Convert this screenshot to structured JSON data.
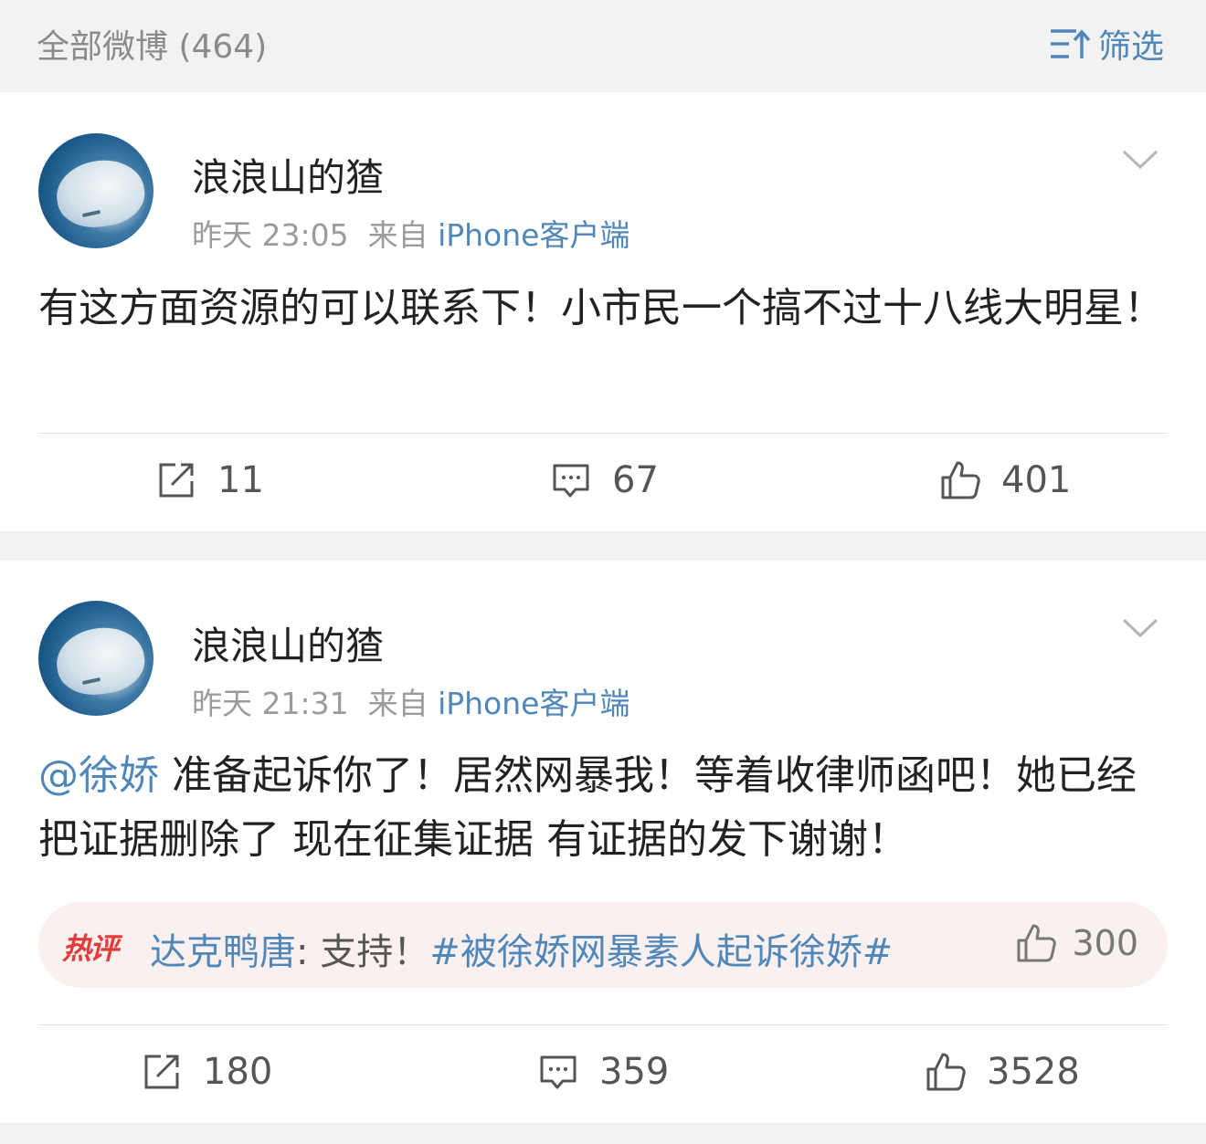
{
  "header": {
    "count_label": "全部微博 (464)",
    "filter_label": "筛选"
  },
  "posts": [
    {
      "username": "浪浪山的猹",
      "time": "昨天 23:05",
      "source_prefix": "来自",
      "source": "iPhone客户端",
      "text": "有这方面资源的可以联系下！小市民一个搞不过十八线大明星！",
      "reposts": "11",
      "comments": "67",
      "likes": "401"
    },
    {
      "username": "浪浪山的猹",
      "time": "昨天 21:31",
      "source_prefix": "来自",
      "source": "iPhone客户端",
      "mention": "@徐娇",
      "text": " 准备起诉你了！居然网暴我！等着收律师函吧！她已经把证据删除了 现在征集证据 有证据的发下谢谢！",
      "hot_comment": {
        "badge": "热评",
        "author": "达克鸭唐",
        "text": ": 支持！",
        "hashtag": "#被徐娇网暴素人起诉徐娇#",
        "likes": "300"
      },
      "reposts": "180",
      "comments": "359",
      "likes": "3528"
    }
  ]
}
